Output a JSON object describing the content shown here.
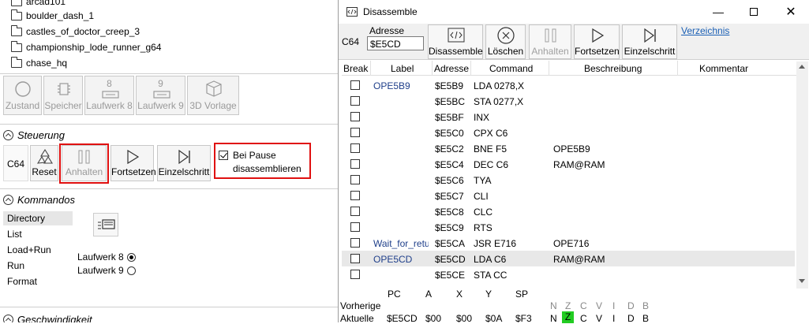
{
  "files": [
    "arcad101",
    "boulder_dash_1",
    "castles_of_doctor_creep_3",
    "championship_lode_runner_g64",
    "chase_hq"
  ],
  "device_buttons": [
    {
      "label": "Zustand",
      "icon": "circle-icon"
    },
    {
      "label": "Speicher",
      "icon": "chip-icon"
    },
    {
      "label": "Laufwerk 8",
      "number": "8",
      "icon": "drive-icon"
    },
    {
      "label": "Laufwerk 9",
      "number": "9",
      "icon": "drive-icon"
    },
    {
      "label": "3D Vorlage",
      "icon": "cube-icon"
    }
  ],
  "steuerung": {
    "title": "Steuerung",
    "machine": "C64",
    "reset": "Reset",
    "anhalten": "Anhalten",
    "fortsetzen": "Fortsetzen",
    "einzelschritt": "Einzelschritt",
    "pause_line1": "Bei Pause",
    "pause_line2": "disassemblieren"
  },
  "kommandos": {
    "title": "Kommandos",
    "items": [
      "Directory",
      "List",
      "Load+Run",
      "Run",
      "Format"
    ],
    "drives": [
      "Laufwerk 8",
      "Laufwerk 9"
    ]
  },
  "geschwindigkeit": {
    "title": "Geschwindigkeit"
  },
  "window": {
    "title": "Disassemble",
    "machine": "C64",
    "address_label": "Adresse",
    "address_value": "$E5CD",
    "buttons": {
      "disassemble": "Disassemble",
      "loeschen": "Löschen",
      "anhalten": "Anhalten",
      "fortsetzen": "Fortsetzen",
      "einzelschritt": "Einzelschritt"
    },
    "verzeichnis": "Verzeichnis",
    "columns": [
      "Break",
      "Label",
      "Adresse",
      "Command",
      "Beschreibung",
      "Kommentar"
    ],
    "rows": [
      {
        "label": "OPE5B9",
        "addr": "$E5B9",
        "cmd": "LDA 0278,X",
        "desc": ""
      },
      {
        "label": "",
        "addr": "$E5BC",
        "cmd": "STA 0277,X",
        "desc": ""
      },
      {
        "label": "",
        "addr": "$E5BF",
        "cmd": "INX",
        "desc": ""
      },
      {
        "label": "",
        "addr": "$E5C0",
        "cmd": "CPX C6",
        "desc": ""
      },
      {
        "label": "",
        "addr": "$E5C2",
        "cmd": "BNE F5",
        "desc": "OPE5B9"
      },
      {
        "label": "",
        "addr": "$E5C4",
        "cmd": "DEC C6",
        "desc": "RAM@RAM"
      },
      {
        "label": "",
        "addr": "$E5C6",
        "cmd": "TYA",
        "desc": ""
      },
      {
        "label": "",
        "addr": "$E5C7",
        "cmd": "CLI",
        "desc": ""
      },
      {
        "label": "",
        "addr": "$E5C8",
        "cmd": "CLC",
        "desc": ""
      },
      {
        "label": "",
        "addr": "$E5C9",
        "cmd": "RTS",
        "desc": ""
      },
      {
        "label": "Wait_for_retu",
        "addr": "$E5CA",
        "cmd": "JSR E716",
        "desc": "OPE716"
      },
      {
        "label": "OPE5CD",
        "addr": "$E5CD",
        "cmd": "LDA C6",
        "desc": "RAM@RAM"
      },
      {
        "label": "",
        "addr": "$E5CE",
        "cmd": "STA CC",
        "desc": ""
      }
    ],
    "registers": {
      "headers": [
        "PC",
        "A",
        "X",
        "Y",
        "SP"
      ],
      "previous_label": "Vorherige",
      "current_label": "Aktuelle",
      "current": [
        "$E5CD",
        "$00",
        "$00",
        "$0A",
        "$F3"
      ],
      "flags": [
        "N",
        "Z",
        "C",
        "V",
        "I",
        "D",
        "B"
      ]
    }
  },
  "colors": {
    "highlight_flag": "#22cc22",
    "selection_box": "#e01010",
    "link": "#1a5fb4"
  }
}
